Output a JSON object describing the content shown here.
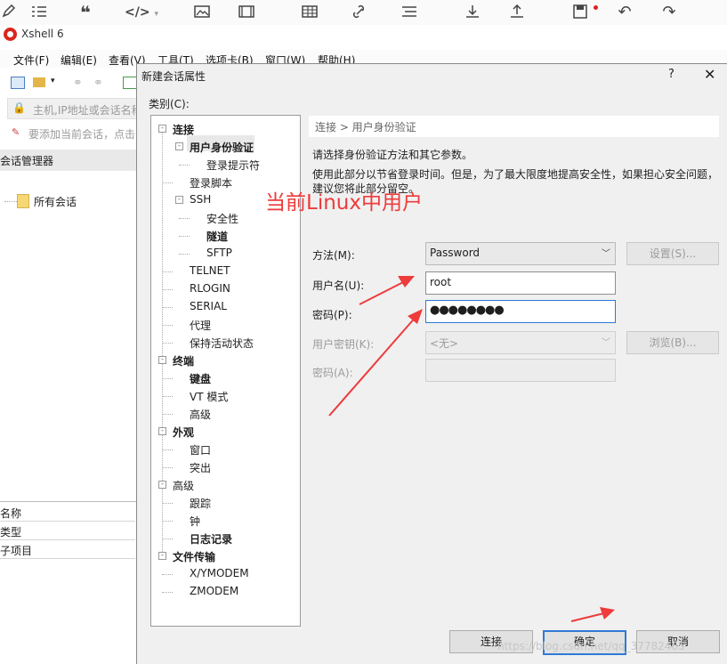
{
  "app": {
    "title": "Xshell 6"
  },
  "menu": [
    "文件(F)",
    "编辑(E)",
    "查看(V)",
    "工具(T)",
    "选项卡(B)",
    "窗口(W)",
    "帮助(H)"
  ],
  "address_placeholder": "主机,IP地址或会话名称",
  "hint": "要添加当前会话，点击",
  "session_manager": {
    "title": "会话管理器",
    "root": "所有会话",
    "properties": [
      "名称",
      "类型",
      "子项目"
    ]
  },
  "dialog": {
    "title": "新建会话属性",
    "help": "?",
    "close": "✕",
    "category_label": "类别(C):",
    "tree": [
      {
        "label": "连接",
        "bold": true,
        "level": 0,
        "box": "-"
      },
      {
        "label": "用户身份验证",
        "bold": true,
        "level": 1,
        "box": "-",
        "selected": true
      },
      {
        "label": "登录提示符",
        "bold": false,
        "level": 2
      },
      {
        "label": "登录脚本",
        "bold": false,
        "level": 1
      },
      {
        "label": "SSH",
        "bold": false,
        "level": 1,
        "box": "-"
      },
      {
        "label": "安全性",
        "bold": false,
        "level": 2
      },
      {
        "label": "隧道",
        "bold": true,
        "level": 2
      },
      {
        "label": "SFTP",
        "bold": false,
        "level": 2
      },
      {
        "label": "TELNET",
        "bold": false,
        "level": 1
      },
      {
        "label": "RLOGIN",
        "bold": false,
        "level": 1
      },
      {
        "label": "SERIAL",
        "bold": false,
        "level": 1
      },
      {
        "label": "代理",
        "bold": false,
        "level": 1
      },
      {
        "label": "保持活动状态",
        "bold": false,
        "level": 1
      },
      {
        "label": "终端",
        "bold": true,
        "level": 0,
        "box": "-"
      },
      {
        "label": "键盘",
        "bold": true,
        "level": 1
      },
      {
        "label": "VT 模式",
        "bold": false,
        "level": 1
      },
      {
        "label": "高级",
        "bold": false,
        "level": 1
      },
      {
        "label": "外观",
        "bold": true,
        "level": 0,
        "box": "-"
      },
      {
        "label": "窗口",
        "bold": false,
        "level": 1
      },
      {
        "label": "突出",
        "bold": false,
        "level": 1
      },
      {
        "label": "高级",
        "bold": false,
        "level": 0,
        "box": "-"
      },
      {
        "label": "跟踪",
        "bold": false,
        "level": 1
      },
      {
        "label": "钟",
        "bold": false,
        "level": 1
      },
      {
        "label": "日志记录",
        "bold": true,
        "level": 1
      },
      {
        "label": "文件传输",
        "bold": true,
        "level": 0,
        "box": "-"
      },
      {
        "label": "X/YMODEM",
        "bold": false,
        "level": 1
      },
      {
        "label": "ZMODEM",
        "bold": false,
        "level": 1
      }
    ],
    "breadcrumb": "连接 > 用户身份验证",
    "desc1": "请选择身份验证方法和其它参数。",
    "desc2": "使用此部分以节省登录时间。但是，为了最大限度地提高安全性，如果担心安全问题，建议您将此部分留空。",
    "method_label": "方法(M):",
    "method_value": "Password",
    "settings_btn": "设置(S)...",
    "username_label": "用户名(U):",
    "username_value": "root",
    "password_label": "密码(P):",
    "password_value": "●●●●●●●●",
    "userkey_label": "用户密钥(K):",
    "userkey_value": "<无>",
    "browse_btn": "浏览(B)...",
    "passphrase_label": "密码(A):",
    "connect_btn": "连接",
    "ok_btn": "确定",
    "cancel_btn": "取消"
  },
  "annotation": "当前Linux中用户",
  "watermark": "https://blog.csdn.net/qq_37782465",
  "colors": {
    "annotation": "#ee3b3b",
    "focus": "#2b7ad6",
    "logo": "#d9261c"
  }
}
